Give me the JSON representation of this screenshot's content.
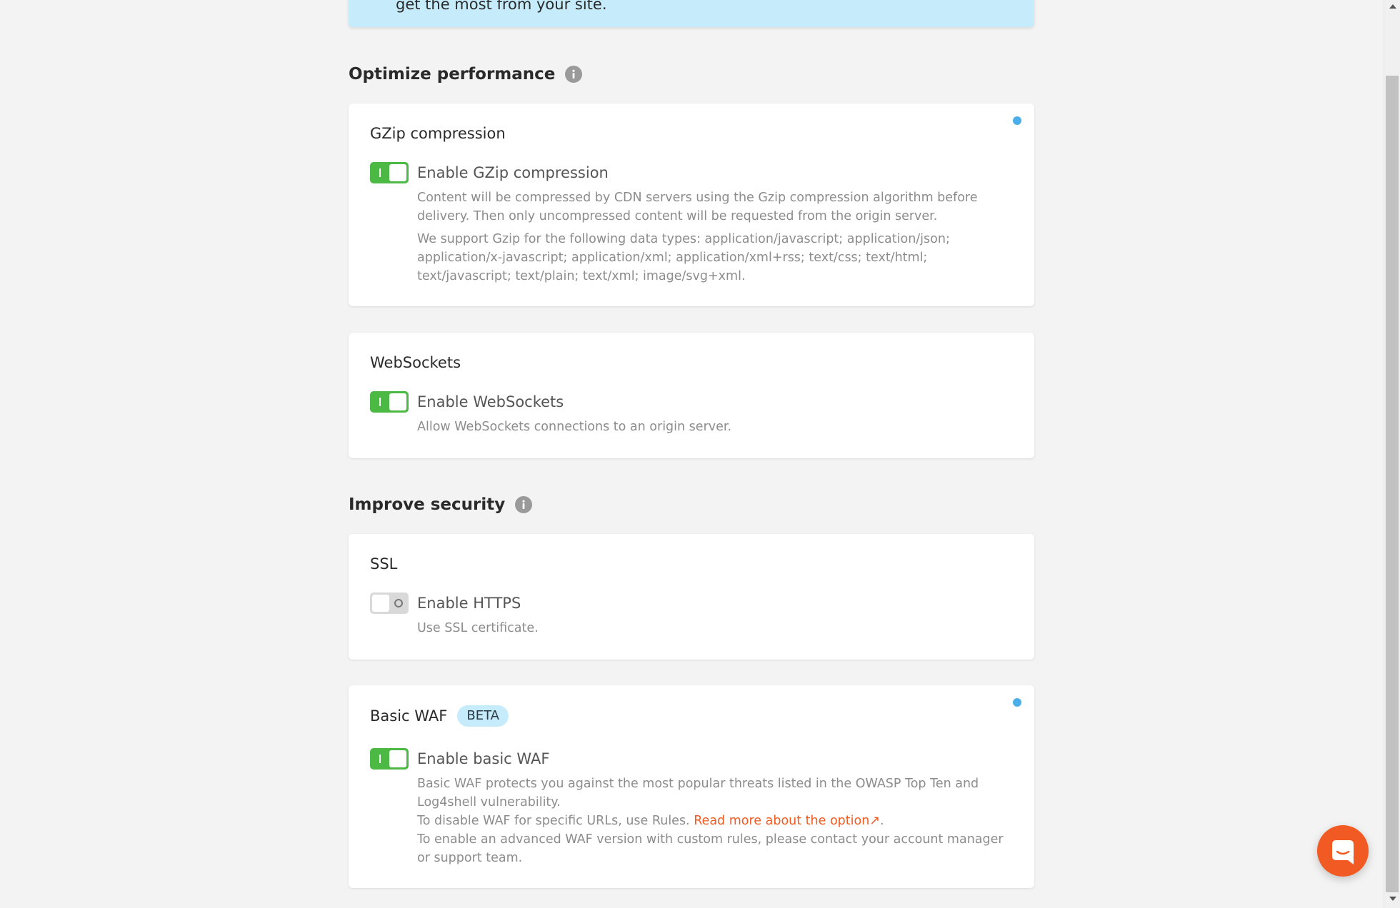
{
  "banner": {
    "text": "get the most from your site."
  },
  "performance": {
    "heading": "Optimize performance",
    "gzip": {
      "title": "GZip compression",
      "enabled": true,
      "toggle_label": "Enable GZip compression",
      "desc1": "Content will be compressed by CDN servers using the Gzip compression algorithm before delivery. Then only uncompressed content will be requested from the origin server.",
      "desc2": "We support Gzip for the following data types: application/javascript; application/json; application/x-javascript; application/xml; application/xml+rss; text/css; text/html; text/javascript; text/plain; text/xml; image/svg+xml."
    },
    "websockets": {
      "title": "WebSockets",
      "enabled": true,
      "toggle_label": "Enable WebSockets",
      "desc": "Allow WebSockets connections to an origin server."
    }
  },
  "security": {
    "heading": "Improve security",
    "ssl": {
      "title": "SSL",
      "enabled": false,
      "toggle_label": "Enable HTTPS",
      "desc": "Use SSL certificate."
    },
    "waf": {
      "title": "Basic WAF",
      "badge": "BETA",
      "enabled": true,
      "toggle_label": "Enable basic WAF",
      "desc1": "Basic WAF protects you against the most popular threats listed in the OWASP Top Ten and Log4shell vulnerability.",
      "desc2_prefix": "To disable WAF for specific URLs, use Rules. ",
      "desc2_link": "Read more about the option",
      "desc2_link_icon": "↗",
      "desc2_suffix": ".",
      "desc3": "To enable an advanced WAF version with custom rules, please contact your account manager or support team."
    }
  },
  "colors": {
    "toggle_on": "#4cb944",
    "accent_link": "#f15a22",
    "unsaved_dot": "#4aaee8",
    "banner_bg": "#c6ecfb"
  },
  "icons": {
    "info": "info-icon",
    "chat": "chat-icon",
    "external_link": "external-link-icon"
  }
}
